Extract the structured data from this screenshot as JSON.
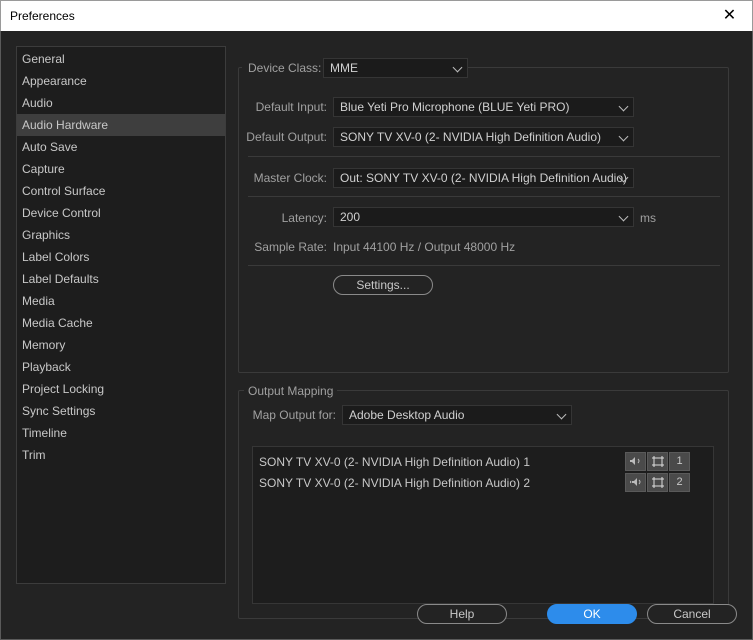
{
  "window": {
    "title": "Preferences",
    "close_glyph": "✕"
  },
  "sidebar": {
    "items": [
      {
        "label": "General"
      },
      {
        "label": "Appearance"
      },
      {
        "label": "Audio"
      },
      {
        "label": "Audio Hardware",
        "selected": true
      },
      {
        "label": "Auto Save"
      },
      {
        "label": "Capture"
      },
      {
        "label": "Control Surface"
      },
      {
        "label": "Device Control"
      },
      {
        "label": "Graphics"
      },
      {
        "label": "Label Colors"
      },
      {
        "label": "Label Defaults"
      },
      {
        "label": "Media"
      },
      {
        "label": "Media Cache"
      },
      {
        "label": "Memory"
      },
      {
        "label": "Playback"
      },
      {
        "label": "Project Locking"
      },
      {
        "label": "Sync Settings"
      },
      {
        "label": "Timeline"
      },
      {
        "label": "Trim"
      }
    ]
  },
  "hardware": {
    "device_class_label": "Device Class:",
    "device_class": "MME",
    "default_input_label": "Default Input:",
    "default_input": "Blue Yeti Pro Microphone (BLUE Yeti PRO)",
    "default_output_label": "Default Output:",
    "default_output": "SONY TV XV-0 (2- NVIDIA High Definition Audio)",
    "master_clock_label": "Master Clock:",
    "master_clock": "Out: SONY TV XV-0 (2- NVIDIA High Definition Audio)",
    "latency_label": "Latency:",
    "latency": "200",
    "latency_unit": "ms",
    "sample_rate_label": "Sample Rate:",
    "sample_rate": "Input 44100 Hz / Output 48000 Hz",
    "settings_button": "Settings..."
  },
  "output_mapping": {
    "legend": "Output Mapping",
    "map_for_label": "Map Output for:",
    "map_for": "Adobe Desktop Audio",
    "outputs": [
      {
        "label": "SONY TV XV-0 (2- NVIDIA High Definition Audio) 1",
        "channel": "1",
        "speaker_icon": "speaker-left-icon"
      },
      {
        "label": "SONY TV XV-0 (2- NVIDIA High Definition Audio) 2",
        "channel": "2",
        "speaker_icon": "speaker-right-icon"
      }
    ]
  },
  "footer": {
    "help": "Help",
    "ok": "OK",
    "cancel": "Cancel"
  },
  "colors": {
    "accent": "#2d8ceb",
    "background": "#232323",
    "panel": "#1d1d1d",
    "selected": "#3e3e3e"
  }
}
